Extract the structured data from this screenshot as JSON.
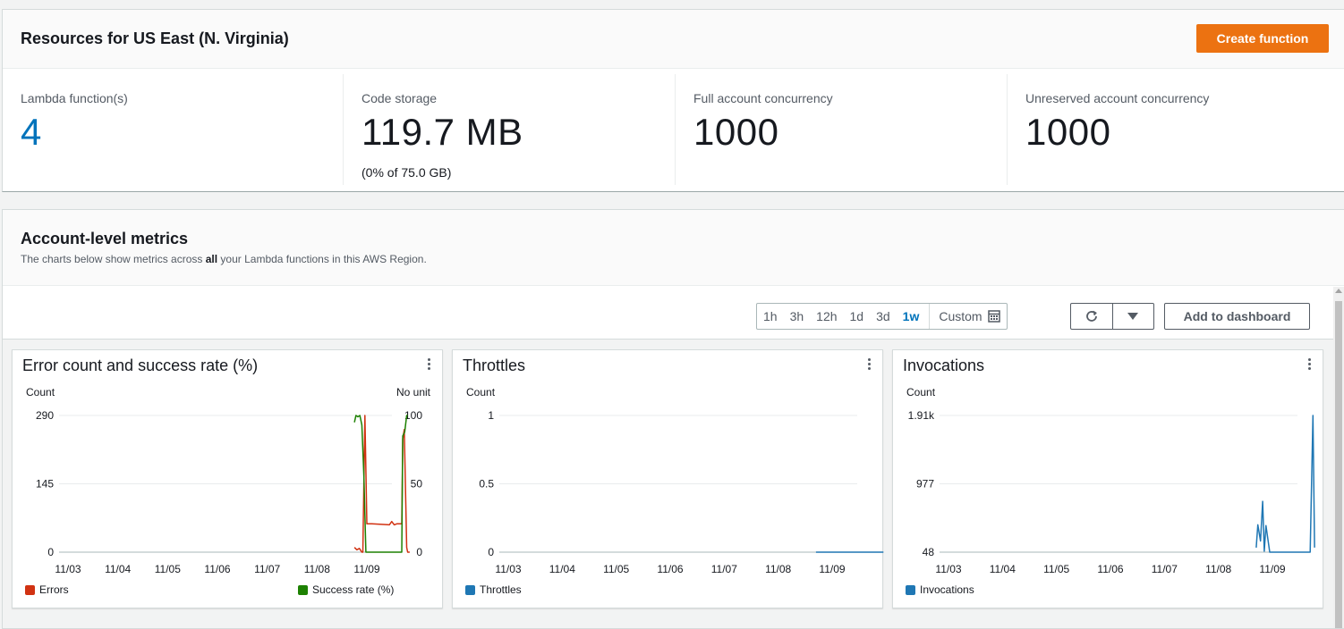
{
  "resources": {
    "title": "Resources for US East (N. Virginia)",
    "create_label": "Create function",
    "stats": [
      {
        "label": "Lambda function(s)",
        "value": "4",
        "sub": ""
      },
      {
        "label": "Code storage",
        "value": "119.7 MB",
        "sub": "(0% of 75.0 GB)"
      },
      {
        "label": "Full account concurrency",
        "value": "1000",
        "sub": ""
      },
      {
        "label": "Unreserved account concurrency",
        "value": "1000",
        "sub": ""
      }
    ]
  },
  "metrics": {
    "title": "Account-level metrics",
    "desc_pre": "The charts below show metrics across ",
    "desc_bold": "all",
    "desc_post": " your Lambda functions in this AWS Region.",
    "ranges": [
      "1h",
      "3h",
      "12h",
      "1d",
      "3d",
      "1w"
    ],
    "active_range": "1w",
    "custom_label": "Custom",
    "add_dashboard_label": "Add to dashboard",
    "icons": {
      "refresh": "refresh-icon",
      "dropdown": "caret-down-icon",
      "calendar": "calendar-icon",
      "menu": "kebab-menu-icon"
    }
  },
  "colors": {
    "primary": "#ec7211",
    "link": "#0073bb",
    "errors": "#d13212",
    "success": "#1d8102",
    "series_blue": "#1f77b4"
  },
  "chart_data": [
    {
      "type": "line",
      "title": "Error count and success rate (%)",
      "ylabel": "Count",
      "ylabel_right": "No unit",
      "x_ticks": [
        "11/03",
        "11/04",
        "11/05",
        "11/06",
        "11/07",
        "11/08",
        "11/09"
      ],
      "y_ticks": [
        "0",
        "145",
        "290"
      ],
      "y_ticks_right": [
        "0",
        "50",
        "100"
      ],
      "ylim": [
        0,
        290
      ],
      "ylim_right": [
        0,
        100
      ],
      "series": [
        {
          "name": "Errors",
          "axis": "left",
          "color": "#d13212",
          "x": [
            5.75,
            5.8,
            5.85,
            5.9,
            5.92,
            5.96,
            6.0,
            6.1,
            6.3,
            6.45,
            6.5,
            6.55,
            6.6,
            6.7,
            6.72,
            6.75,
            6.8,
            6.82,
            6.86
          ],
          "y": [
            10,
            5,
            8,
            0,
            0,
            290,
            60,
            60,
            59,
            58,
            65,
            58,
            60,
            60,
            240,
            260,
            10,
            0,
            0
          ]
        },
        {
          "name": "Success rate (%)",
          "axis": "right",
          "color": "#1d8102",
          "x": [
            5.75,
            5.78,
            5.82,
            5.86,
            5.9,
            5.94,
            5.98,
            6.0,
            6.1,
            6.4,
            6.7,
            6.72,
            6.76,
            6.8,
            6.82
          ],
          "y": [
            95,
            100,
            99,
            100,
            93,
            55,
            0,
            0,
            0,
            0,
            0,
            85,
            88,
            100,
            100
          ]
        }
      ]
    },
    {
      "type": "line",
      "title": "Throttles",
      "ylabel": "Count",
      "x_ticks": [
        "11/03",
        "11/04",
        "11/05",
        "11/06",
        "11/07",
        "11/08",
        "11/09"
      ],
      "y_ticks": [
        "0",
        "0.5",
        "1"
      ],
      "ylim": [
        0,
        1
      ],
      "series": [
        {
          "name": "Throttles",
          "color": "#1f77b4",
          "x": [
            5.7,
            6.95
          ],
          "y": [
            0,
            0
          ]
        }
      ]
    },
    {
      "type": "line",
      "title": "Invocations",
      "ylabel": "Count",
      "x_ticks": [
        "11/03",
        "11/04",
        "11/05",
        "11/06",
        "11/07",
        "11/08",
        "11/09"
      ],
      "y_ticks": [
        "48",
        "977",
        "1.91k"
      ],
      "ylim": [
        48,
        1910
      ],
      "series": [
        {
          "name": "Invocations",
          "color": "#1f77b4",
          "x": [
            5.7,
            5.73,
            5.78,
            5.82,
            5.85,
            5.88,
            5.95,
            6.3,
            6.65,
            6.7,
            6.75,
            6.78
          ],
          "y": [
            110,
            420,
            200,
            740,
            60,
            410,
            48,
            48,
            48,
            48,
            1910,
            110
          ]
        }
      ]
    }
  ]
}
